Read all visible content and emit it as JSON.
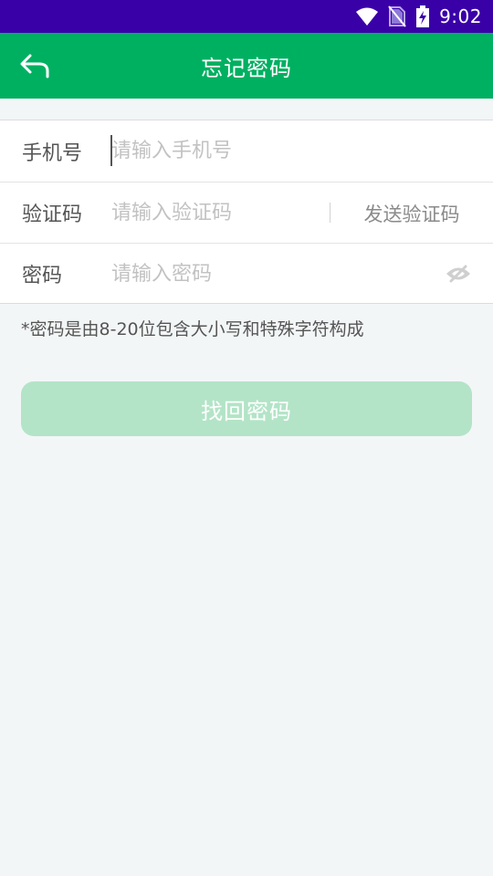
{
  "status_bar": {
    "time": "9:02",
    "icons": [
      "wifi-icon",
      "no-sim-icon",
      "battery-charging-icon"
    ]
  },
  "header": {
    "title": "忘记密码",
    "back_icon": "back-arrow-icon"
  },
  "form": {
    "phone": {
      "label": "手机号",
      "placeholder": "请输入手机号"
    },
    "code": {
      "label": "验证码",
      "placeholder": "请输入验证码",
      "send_label": "发送验证码"
    },
    "password": {
      "label": "密码",
      "placeholder": "请输入密码",
      "toggle_icon": "eye-off-icon"
    }
  },
  "hint": "*密码是由8-20位包含大小写和特殊字符构成",
  "submit_label": "找回密码",
  "colors": {
    "status_bar": "#3a00a8",
    "app_bar": "#00b061",
    "button_disabled": "#b3e4c7",
    "background": "#f3f6f7"
  }
}
